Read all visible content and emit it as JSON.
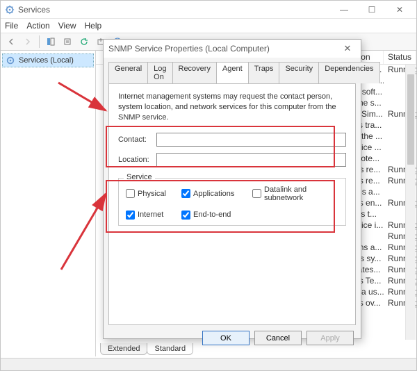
{
  "main_window": {
    "title": "Services",
    "menu": {
      "file": "File",
      "action": "Action",
      "view": "View",
      "help": "Help"
    },
    "tree": {
      "root": "Services (Local)"
    },
    "list": {
      "headers": {
        "description": "scription",
        "status": "Status"
      },
      "rows": [
        {
          "desc": "ovides no...",
          "status": "Running"
        },
        {
          "desc": "anages ac...",
          "status": ""
        },
        {
          "desc": "eates soft...",
          "status": ""
        },
        {
          "desc": "ows the s...",
          "status": ""
        },
        {
          "desc": "ables Sim...",
          "status": "Running"
        },
        {
          "desc": "ceives tra...",
          "status": ""
        },
        {
          "desc": "ables the ...",
          "status": ""
        },
        {
          "desc": "s service ...",
          "status": ""
        },
        {
          "desc": "ifies pote...",
          "status": ""
        },
        {
          "desc": "covers re...",
          "status": "Running"
        },
        {
          "desc": "ovides re...",
          "status": "Running"
        },
        {
          "desc": "unches a...",
          "status": ""
        },
        {
          "desc": "ovides en...",
          "status": "Running"
        },
        {
          "desc": "timizes t...",
          "status": ""
        },
        {
          "desc": "s service i...",
          "status": "Running"
        },
        {
          "desc": "",
          "status": "Running"
        },
        {
          "desc": "aintains a...",
          "status": "Running"
        },
        {
          "desc": "onitors sy...",
          "status": "Running"
        },
        {
          "desc": "ordinates...",
          "status": "Running"
        },
        {
          "desc": "ovides Te...",
          "status": "Running"
        },
        {
          "desc": "ables a us...",
          "status": "Running"
        },
        {
          "desc": "ovides ov...",
          "status": "Running"
        }
      ]
    },
    "bottom_tabs": {
      "extended": "Extended",
      "standard": "Standard"
    }
  },
  "dialog": {
    "title": "SNMP Service Properties (Local Computer)",
    "tabs": {
      "general": "General",
      "logon": "Log On",
      "recovery": "Recovery",
      "agent": "Agent",
      "traps": "Traps",
      "security": "Security",
      "dependencies": "Dependencies"
    },
    "info": "Internet management systems may request the contact person, system location, and network services for this computer from the SNMP service.",
    "fields": {
      "contact_label": "Contact:",
      "location_label": "Location:",
      "contact_value": "",
      "location_value": ""
    },
    "service_box": {
      "legend": "Service",
      "physical": "Physical",
      "applications": "Applications",
      "datalink": "Datalink and subnetwork",
      "internet": "Internet",
      "endtoend": "End-to-end"
    },
    "buttons": {
      "ok": "OK",
      "cancel": "Cancel",
      "apply": "Apply"
    }
  }
}
